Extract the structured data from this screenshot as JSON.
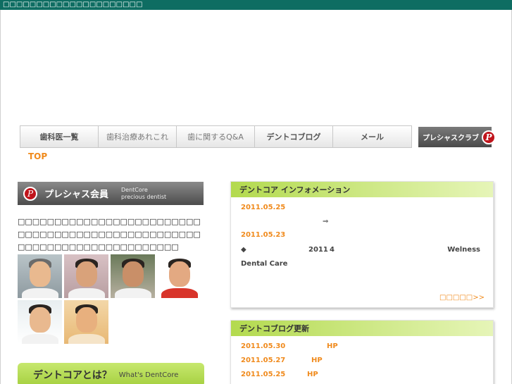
{
  "topbar": {
    "text": "□□□□□□□□□□□□□□□□□□□□□"
  },
  "nav": {
    "items": [
      {
        "label": "歯科医一覧"
      },
      {
        "label": "歯科治療あれこれ"
      },
      {
        "label": "歯に関するQ&A"
      },
      {
        "label": "デントコブログ"
      },
      {
        "label": "メール"
      }
    ],
    "special": {
      "label": "プレシャスクラブ",
      "logo": "P"
    }
  },
  "top_link": "TOP",
  "left": {
    "banner": {
      "logo": "P",
      "title": "プレシャス会員",
      "sub1": "DentCore",
      "sub2": "precious dentist"
    },
    "intro": "□□□□□□□□□□□□□□□□□□□□□□□□□□□□□□□□□□□□□□□□□□□□□□□□□□□□□□□□□□□□□□□□□□□□□□□□",
    "whats": {
      "title": "デントコアとは？",
      "sub": "What's DentCore"
    }
  },
  "info_panel": {
    "title": "デントコア インフォメーション",
    "entries": [
      {
        "date": "2011.05.25",
        "arrow": "⇒"
      },
      {
        "date": "2011.05.23",
        "bullet": "◆",
        "year": "2011",
        "num": "4",
        "welness": "Welness",
        "line2": "Dental Care"
      }
    ],
    "more": "□□□□□>>"
  },
  "blog_panel": {
    "title": "デントコブログ更新",
    "entries": [
      {
        "date": "2011.05.30",
        "tag": "HP"
      },
      {
        "date": "2011.05.27",
        "tag": "HP"
      },
      {
        "date": "2011.05.25",
        "tag": "HP"
      }
    ]
  },
  "colors": {
    "header": "#0e6d62",
    "accent": "#f08a1c",
    "green": "#b3da4e"
  }
}
